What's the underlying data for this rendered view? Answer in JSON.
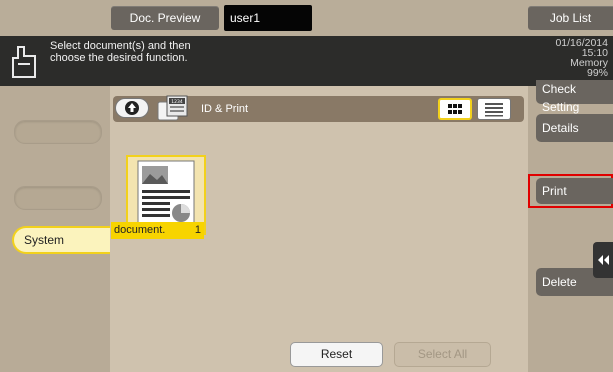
{
  "header": {
    "doc_preview": "Doc. Preview",
    "user": "user1",
    "job_list": "Job List"
  },
  "message": {
    "line1": "Select document(s) and then",
    "line2": "choose the desired function.",
    "date": "01/16/2014",
    "time": "15:10",
    "memory_label": "Memory",
    "memory_value": "99%"
  },
  "left_tabs": {
    "system": "System"
  },
  "folder": {
    "name": "ID & Print",
    "folder_number": "1234"
  },
  "document": {
    "name": "document.",
    "pages": "1"
  },
  "buttons": {
    "reset": "Reset",
    "select_all": "Select All"
  },
  "right_menu": {
    "check_setting": "Check Setting",
    "details": "Details",
    "print": "Print",
    "delete": "Delete"
  },
  "colors": {
    "highlight_yellow": "#f2d11c",
    "print_outline": "#e00000",
    "button_dark": "#6a655f"
  }
}
